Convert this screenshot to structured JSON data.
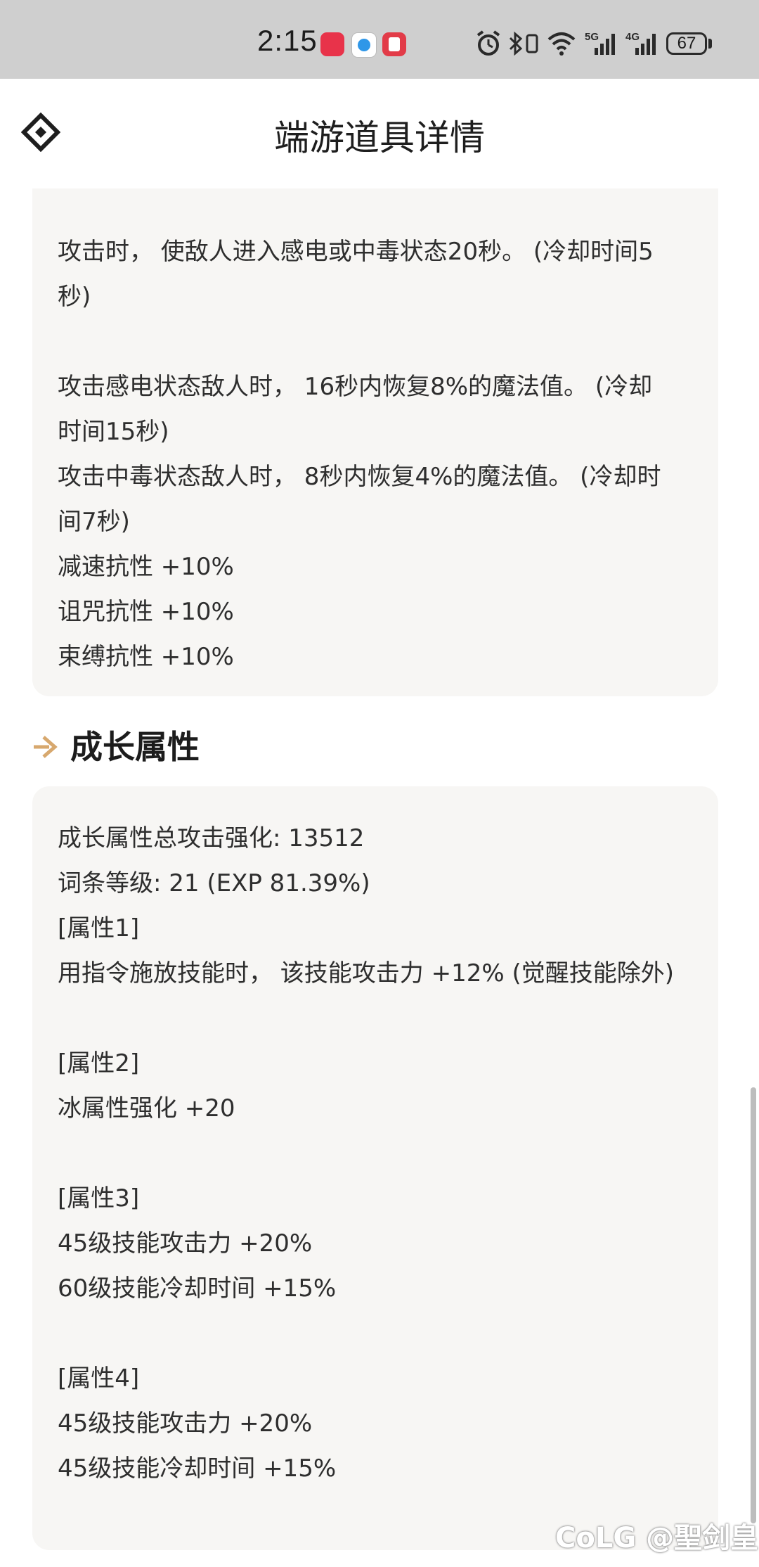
{
  "status_bar": {
    "time": "2:15",
    "battery": "67",
    "net_1": "5G",
    "net_2": "4G",
    "icons": [
      "app-red-icon",
      "app-blue-icon",
      "app-red-book-icon",
      "alarm-icon",
      "bluetooth-icon",
      "vibrate-icon",
      "wifi-icon",
      "signal-5g-icon",
      "signal-4g-icon",
      "battery-icon"
    ]
  },
  "header": {
    "title": "端游道具详情",
    "back_icon": "diamond-back-icon"
  },
  "top_card": {
    "lines": [
      "攻击时， 使敌人进入感电或中毒状态20秒。 (冷却时间5",
      "秒)",
      "",
      "攻击感电状态敌人时， 16秒内恢复8%的魔法值。 (冷却",
      "时间15秒)",
      "攻击中毒状态敌人时， 8秒内恢复4%的魔法值。 (冷却时",
      "间7秒)",
      "减速抗性 +10%",
      "诅咒抗性 +10%",
      "束缚抗性 +10%"
    ]
  },
  "section": {
    "title": "成长属性",
    "icon": "arrow-right-icon",
    "accent": "#d7a86e"
  },
  "bottom_card": {
    "lines": [
      "成长属性总攻击强化: 13512",
      "词条等级: 21 (EXP 81.39%)",
      "[属性1]",
      "用指令施放技能时， 该技能攻击力 +12% (觉醒技能除外)",
      "",
      "[属性2]",
      "冰属性强化 +20",
      "",
      "[属性3]",
      "45级技能攻击力 +20%",
      "60级技能冷却时间 +15%",
      "",
      "[属性4]",
      "45级技能攻击力 +20%",
      "45级技能冷却时间 +15%"
    ]
  },
  "watermark": "CoLG @聖剑皇"
}
